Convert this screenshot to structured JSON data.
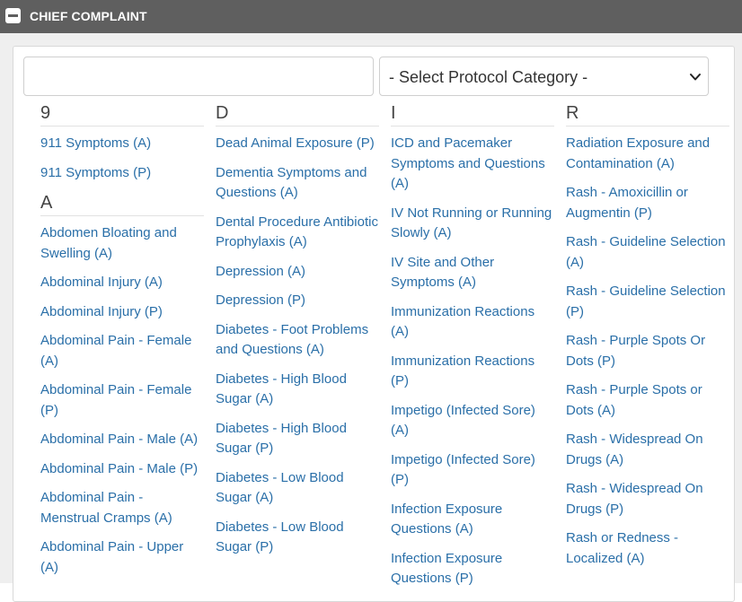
{
  "header": {
    "title": "CHIEF COMPLAINT"
  },
  "search": {
    "value": "",
    "placeholder": ""
  },
  "category_select": {
    "selected": "- Select Protocol Category -"
  },
  "columns": [
    {
      "groups": [
        {
          "letter": "9",
          "items": [
            "911 Symptoms (A)",
            "911 Symptoms (P)"
          ]
        },
        {
          "letter": "A",
          "items": [
            "Abdomen Bloating and Swelling (A)",
            "Abdominal Injury (A)",
            "Abdominal Injury (P)",
            "Abdominal Pain - Female (A)",
            "Abdominal Pain - Female (P)",
            "Abdominal Pain - Male (A)",
            "Abdominal Pain - Male (P)",
            "Abdominal Pain - Menstrual Cramps (A)",
            "Abdominal Pain - Upper (A)"
          ]
        }
      ]
    },
    {
      "groups": [
        {
          "letter": "D",
          "items": [
            "Dead Animal Exposure (P)",
            "Dementia Symptoms and Questions (A)",
            "Dental Procedure Antibiotic Prophylaxis (A)",
            "Depression (A)",
            "Depression (P)",
            "Diabetes - Foot Problems and Questions (A)",
            "Diabetes - High Blood Sugar (A)",
            "Diabetes - High Blood Sugar (P)",
            "Diabetes - Low Blood Sugar (A)",
            "Diabetes - Low Blood Sugar (P)"
          ]
        }
      ]
    },
    {
      "groups": [
        {
          "letter": "I",
          "items": [
            "ICD and Pacemaker Symptoms and Questions (A)",
            "IV Not Running or Running Slowly (A)",
            "IV Site and Other Symptoms (A)",
            "Immunization Reactions (A)",
            "Immunization Reactions (P)",
            "Impetigo (Infected Sore) (A)",
            "Impetigo (Infected Sore) (P)",
            "Infection Exposure Questions (A)",
            "Infection Exposure Questions (P)"
          ]
        }
      ]
    },
    {
      "groups": [
        {
          "letter": "R",
          "items": [
            "Radiation Exposure and Contamination (A)",
            "Rash - Amoxicillin or Augmentin (P)",
            "Rash - Guideline Selection (A)",
            "Rash - Guideline Selection (P)",
            "Rash - Purple Spots Or Dots (P)",
            "Rash - Purple Spots or Dots (A)",
            "Rash - Widespread On Drugs (A)",
            "Rash - Widespread On Drugs (P)",
            "Rash or Redness - Localized (A)"
          ]
        }
      ]
    }
  ],
  "colors": {
    "header_bg": "#5f5f5f",
    "link": "#2a6fa8",
    "body_bg": "#efefef"
  }
}
